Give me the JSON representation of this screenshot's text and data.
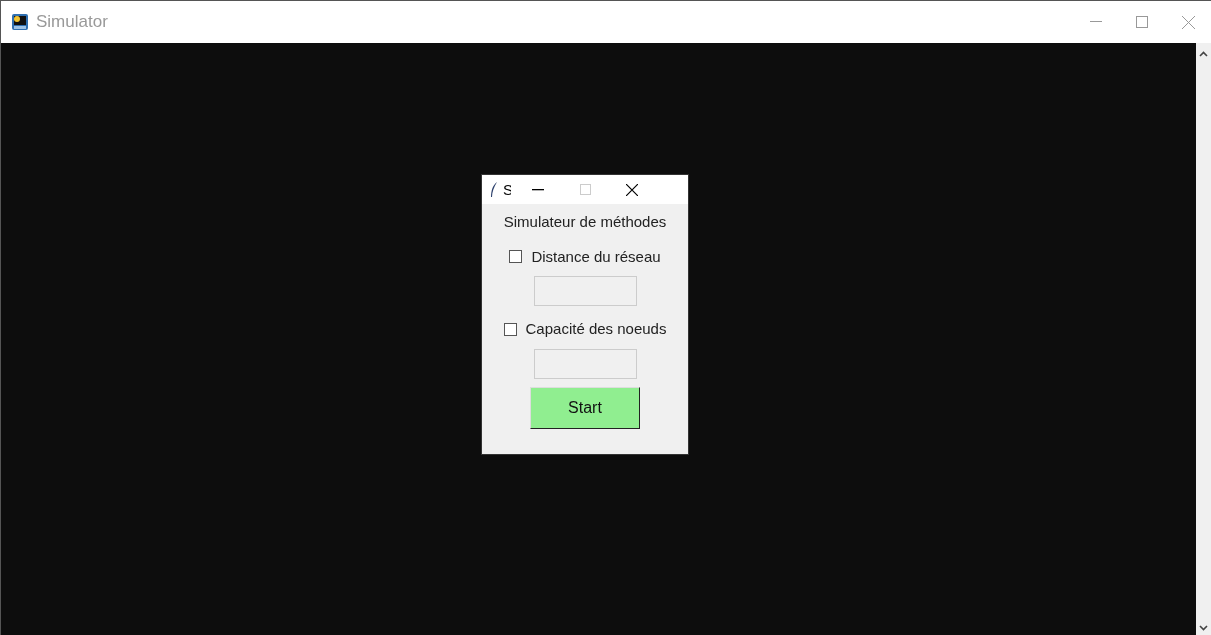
{
  "window": {
    "title": "Simulator"
  },
  "dialog": {
    "title": "S",
    "heading": "Simulateur de méthodes",
    "options": [
      {
        "label": "Distance du réseau",
        "checked": false
      },
      {
        "label": "Capacité des noeuds",
        "checked": false
      }
    ],
    "button": "Start"
  }
}
